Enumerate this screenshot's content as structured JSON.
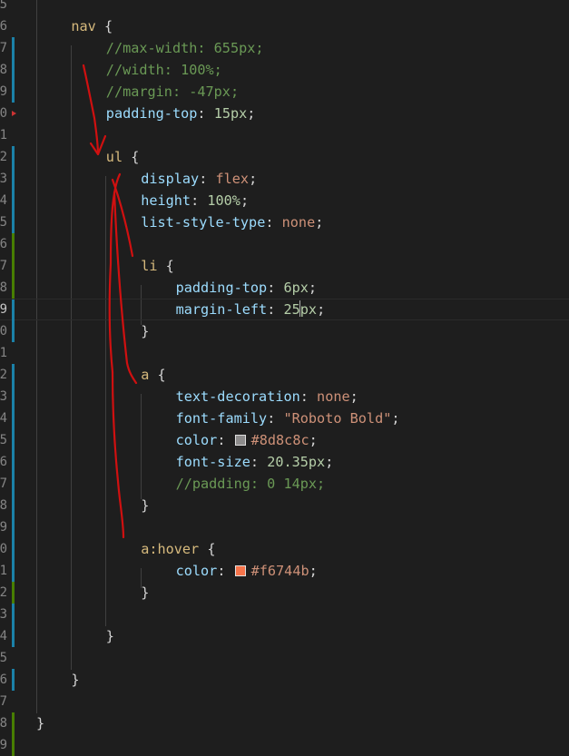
{
  "editor": {
    "language": "css",
    "colors": {
      "background": "#1e1e1e",
      "gutter_modified": "#1b81a8",
      "gutter_added": "#487e02",
      "annotation": "#d01010"
    },
    "lines": [
      {
        "num": "5",
        "marker": "",
        "tokens": []
      },
      {
        "num": "6",
        "marker": "",
        "tokens": [
          {
            "t": "sel",
            "v": "nav"
          },
          {
            "t": "punc",
            "v": " {"
          }
        ]
      },
      {
        "num": "7",
        "marker": "blue",
        "tokens": [
          {
            "t": "comment",
            "v": "//max-width: 655px;"
          }
        ]
      },
      {
        "num": "8",
        "marker": "blue",
        "tokens": [
          {
            "t": "comment",
            "v": "//width: 100%;"
          }
        ]
      },
      {
        "num": "9",
        "marker": "blue",
        "tokens": [
          {
            "t": "comment",
            "v": "//margin: -47px;"
          }
        ]
      },
      {
        "num": "0",
        "marker": "",
        "fold": true,
        "tokens": [
          {
            "t": "prop",
            "v": "padding-top"
          },
          {
            "t": "punc",
            "v": ": "
          },
          {
            "t": "num",
            "v": "15px"
          },
          {
            "t": "punc",
            "v": ";"
          }
        ]
      },
      {
        "num": "1",
        "marker": "",
        "tokens": []
      },
      {
        "num": "2",
        "marker": "blue",
        "tokens": [
          {
            "t": "sel",
            "v": "ul"
          },
          {
            "t": "punc",
            "v": " {"
          }
        ]
      },
      {
        "num": "3",
        "marker": "blue",
        "tokens": [
          {
            "t": "prop",
            "v": "display"
          },
          {
            "t": "punc",
            "v": ": "
          },
          {
            "t": "val",
            "v": "flex"
          },
          {
            "t": "punc",
            "v": ";"
          }
        ]
      },
      {
        "num": "4",
        "marker": "blue",
        "tokens": [
          {
            "t": "prop",
            "v": "height"
          },
          {
            "t": "punc",
            "v": ": "
          },
          {
            "t": "num",
            "v": "100%"
          },
          {
            "t": "punc",
            "v": ";"
          }
        ]
      },
      {
        "num": "5",
        "marker": "blue",
        "tokens": [
          {
            "t": "prop",
            "v": "list-style-type"
          },
          {
            "t": "punc",
            "v": ": "
          },
          {
            "t": "val",
            "v": "none"
          },
          {
            "t": "punc",
            "v": ";"
          }
        ]
      },
      {
        "num": "6",
        "marker": "green",
        "tokens": []
      },
      {
        "num": "7",
        "marker": "green",
        "tokens": [
          {
            "t": "sel",
            "v": "li"
          },
          {
            "t": "punc",
            "v": " {"
          }
        ]
      },
      {
        "num": "8",
        "marker": "green",
        "tokens": [
          {
            "t": "prop",
            "v": "padding-top"
          },
          {
            "t": "punc",
            "v": ": "
          },
          {
            "t": "num",
            "v": "6px"
          },
          {
            "t": "punc",
            "v": ";"
          }
        ]
      },
      {
        "num": "9",
        "marker": "blue",
        "current": true,
        "tokens": [
          {
            "t": "prop",
            "v": "margin-left"
          },
          {
            "t": "punc",
            "v": ": "
          },
          {
            "t": "num",
            "v": "25"
          },
          {
            "t": "cursor",
            "v": ""
          },
          {
            "t": "num",
            "v": "px"
          },
          {
            "t": "punc",
            "v": ";"
          }
        ]
      },
      {
        "num": "0",
        "marker": "blue",
        "tokens": [
          {
            "t": "punc",
            "v": "}"
          }
        ]
      },
      {
        "num": "1",
        "marker": "",
        "tokens": []
      },
      {
        "num": "2",
        "marker": "blue",
        "tokens": [
          {
            "t": "sel",
            "v": "a"
          },
          {
            "t": "punc",
            "v": " {"
          }
        ]
      },
      {
        "num": "3",
        "marker": "blue",
        "tokens": [
          {
            "t": "prop",
            "v": "text-decoration"
          },
          {
            "t": "punc",
            "v": ": "
          },
          {
            "t": "val",
            "v": "none"
          },
          {
            "t": "punc",
            "v": ";"
          }
        ]
      },
      {
        "num": "4",
        "marker": "blue",
        "tokens": [
          {
            "t": "prop",
            "v": "font-family"
          },
          {
            "t": "punc",
            "v": ": "
          },
          {
            "t": "str",
            "v": "\"Roboto Bold\""
          },
          {
            "t": "punc",
            "v": ";"
          }
        ]
      },
      {
        "num": "5",
        "marker": "blue",
        "tokens": [
          {
            "t": "prop",
            "v": "color"
          },
          {
            "t": "punc",
            "v": ": "
          },
          {
            "t": "swatch",
            "v": "#8d8c8c"
          },
          {
            "t": "val",
            "v": "#8d8c8c"
          },
          {
            "t": "punc",
            "v": ";"
          }
        ]
      },
      {
        "num": "6",
        "marker": "blue",
        "tokens": [
          {
            "t": "prop",
            "v": "font-size"
          },
          {
            "t": "punc",
            "v": ": "
          },
          {
            "t": "num",
            "v": "20.35px"
          },
          {
            "t": "punc",
            "v": ";"
          }
        ]
      },
      {
        "num": "7",
        "marker": "blue",
        "tokens": [
          {
            "t": "comment",
            "v": "//padding: 0 14px;"
          }
        ]
      },
      {
        "num": "8",
        "marker": "blue",
        "tokens": [
          {
            "t": "punc",
            "v": "}"
          }
        ]
      },
      {
        "num": "9",
        "marker": "blue",
        "tokens": []
      },
      {
        "num": "0",
        "marker": "blue",
        "tokens": [
          {
            "t": "sel",
            "v": "a:hover"
          },
          {
            "t": "punc",
            "v": " {"
          }
        ]
      },
      {
        "num": "1",
        "marker": "blue",
        "tokens": [
          {
            "t": "prop",
            "v": "color"
          },
          {
            "t": "punc",
            "v": ": "
          },
          {
            "t": "swatch",
            "v": "#f6744b"
          },
          {
            "t": "val",
            "v": "#f6744b"
          },
          {
            "t": "punc",
            "v": ";"
          }
        ]
      },
      {
        "num": "2",
        "marker": "green",
        "tokens": [
          {
            "t": "punc",
            "v": "}"
          }
        ]
      },
      {
        "num": "3",
        "marker": "blue",
        "tokens": []
      },
      {
        "num": "4",
        "marker": "blue",
        "tokens": [
          {
            "t": "punc",
            "v": "}"
          }
        ]
      },
      {
        "num": "5",
        "marker": "",
        "tokens": []
      },
      {
        "num": "6",
        "marker": "blue",
        "tokens": [
          {
            "t": "punc",
            "v": "}"
          }
        ]
      },
      {
        "num": "7",
        "marker": "",
        "tokens": []
      },
      {
        "num": "8",
        "marker": "green",
        "tokens": [
          {
            "t": "punc",
            "v": "}"
          }
        ]
      },
      {
        "num": "9",
        "marker": "green",
        "tokens": []
      }
    ]
  }
}
